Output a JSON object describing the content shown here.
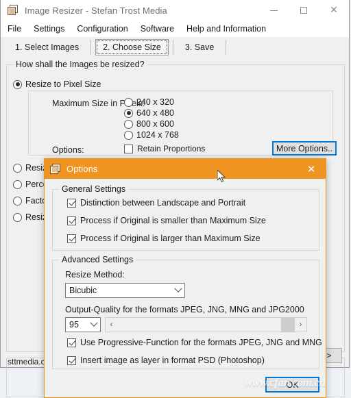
{
  "window": {
    "title": "Image Resizer - Stefan Trost Media",
    "icon": "stacked-frames-icon",
    "controls": {
      "minimize": "minimize-icon",
      "maximize": "maximize-icon",
      "close": "close-icon"
    }
  },
  "menu": {
    "items": [
      {
        "label": "File"
      },
      {
        "label": "Settings"
      },
      {
        "label": "Configuration"
      },
      {
        "label": "Software"
      },
      {
        "label": "Help and Information"
      }
    ]
  },
  "tabs": {
    "items": [
      {
        "label": "1. Select Images",
        "selected": false
      },
      {
        "label": "2. Choose Size",
        "selected": true
      },
      {
        "label": "3. Save",
        "selected": false
      }
    ]
  },
  "main": {
    "group_title": "How shall the Images be resized?",
    "mode_options": [
      {
        "label": "Resize to Pixel Size",
        "checked": true
      },
      {
        "label": "Resize",
        "checked": false
      },
      {
        "label": "Perce",
        "checked": false
      },
      {
        "label": "Facto",
        "checked": false
      },
      {
        "label": "Resize",
        "checked": false
      }
    ],
    "max_size_label": "Maximum Size in Pixels:",
    "size_options": [
      {
        "label": "240 x 320",
        "checked": false
      },
      {
        "label": "640 x 480",
        "checked": true
      },
      {
        "label": "800 x 600",
        "checked": false
      },
      {
        "label": "1024 x 768",
        "checked": false
      }
    ],
    "options_label": "Options:",
    "retain_proportions": {
      "label": "Retain Proportions",
      "checked": false
    },
    "more_options_button": "More Options..",
    "status_text": "sttmedia.co",
    "next_button": ">"
  },
  "dialog": {
    "title": "Options",
    "icon": "stacked-frames-icon",
    "close_icon": "close-icon",
    "general": {
      "title": "General Settings",
      "checkboxes": [
        {
          "label": "Distinction between Landscape and Portrait",
          "checked": true
        },
        {
          "label": "Process if Original is smaller than Maximum Size",
          "checked": true
        },
        {
          "label": "Process if Original is larger than Maximum Size",
          "checked": true
        }
      ]
    },
    "advanced": {
      "title": "Advanced Settings",
      "resize_method_label": "Resize Method:",
      "resize_method_value": "Bicubic",
      "quality_label": "Output-Quality for the formats JPEG, JNG, MNG and JPG2000",
      "quality_value": "95",
      "scroll_left": "‹",
      "scroll_right": "›",
      "checkboxes": [
        {
          "label": "Use Progressive-Function for the formats JPEG, JNG and MNG",
          "checked": true
        },
        {
          "label": "Insert image as layer in format PSD (Photoshop)",
          "checked": true
        }
      ]
    },
    "ok_button": "OK"
  },
  "watermark": "www.cfan.com.cn",
  "colors": {
    "dialog_accent": "#ef9421",
    "focus_blue": "#0078d7",
    "window_bg": "#f0f0f0"
  }
}
